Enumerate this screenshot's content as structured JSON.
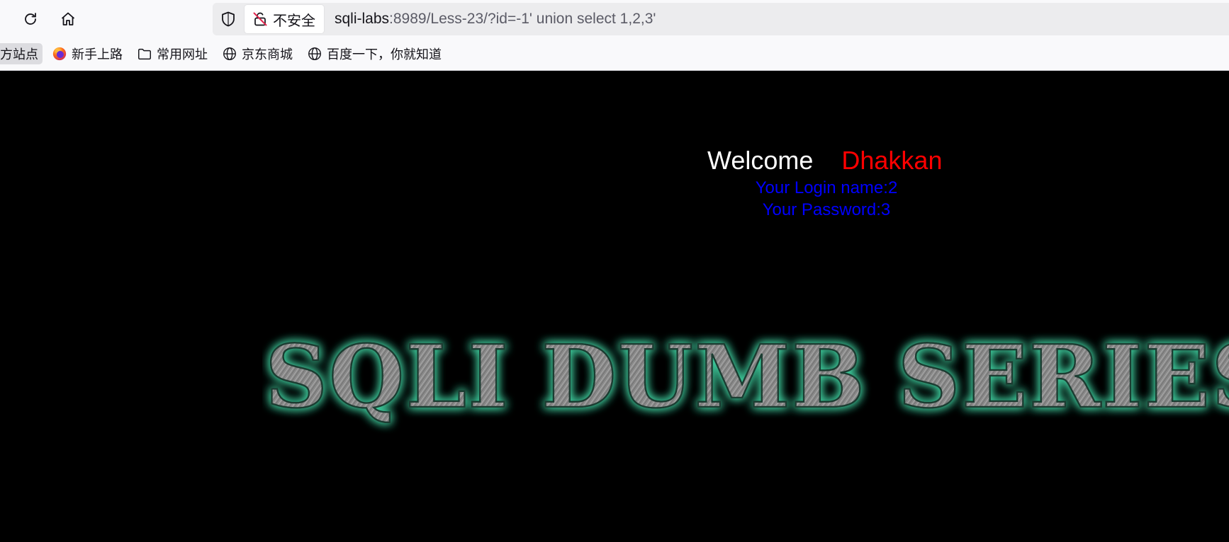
{
  "browser": {
    "security_label": "不安全",
    "url_host": "sqli-labs",
    "url_rest": ":8989/Less-23/?id=-1' union select 1,2,3'",
    "bookmarks": [
      {
        "label": "方站点",
        "icon": "none"
      },
      {
        "label": "新手上路",
        "icon": "firefox-icon"
      },
      {
        "label": "常用网址",
        "icon": "folder-icon"
      },
      {
        "label": "京东商城",
        "icon": "globe-icon"
      },
      {
        "label": "百度一下，你就知道",
        "icon": "globe-icon"
      }
    ]
  },
  "page": {
    "welcome_word": "Welcome",
    "welcome_user": "Dhakkan",
    "login_name_line": "Your Login name:2",
    "password_line": "Your Password:3",
    "banner_text": "SQLI DUMB SERIES-"
  },
  "colors": {
    "welcome_user": "#ff0000",
    "login_info": "#0000ff",
    "banner_glow": "#3fcf9f"
  }
}
